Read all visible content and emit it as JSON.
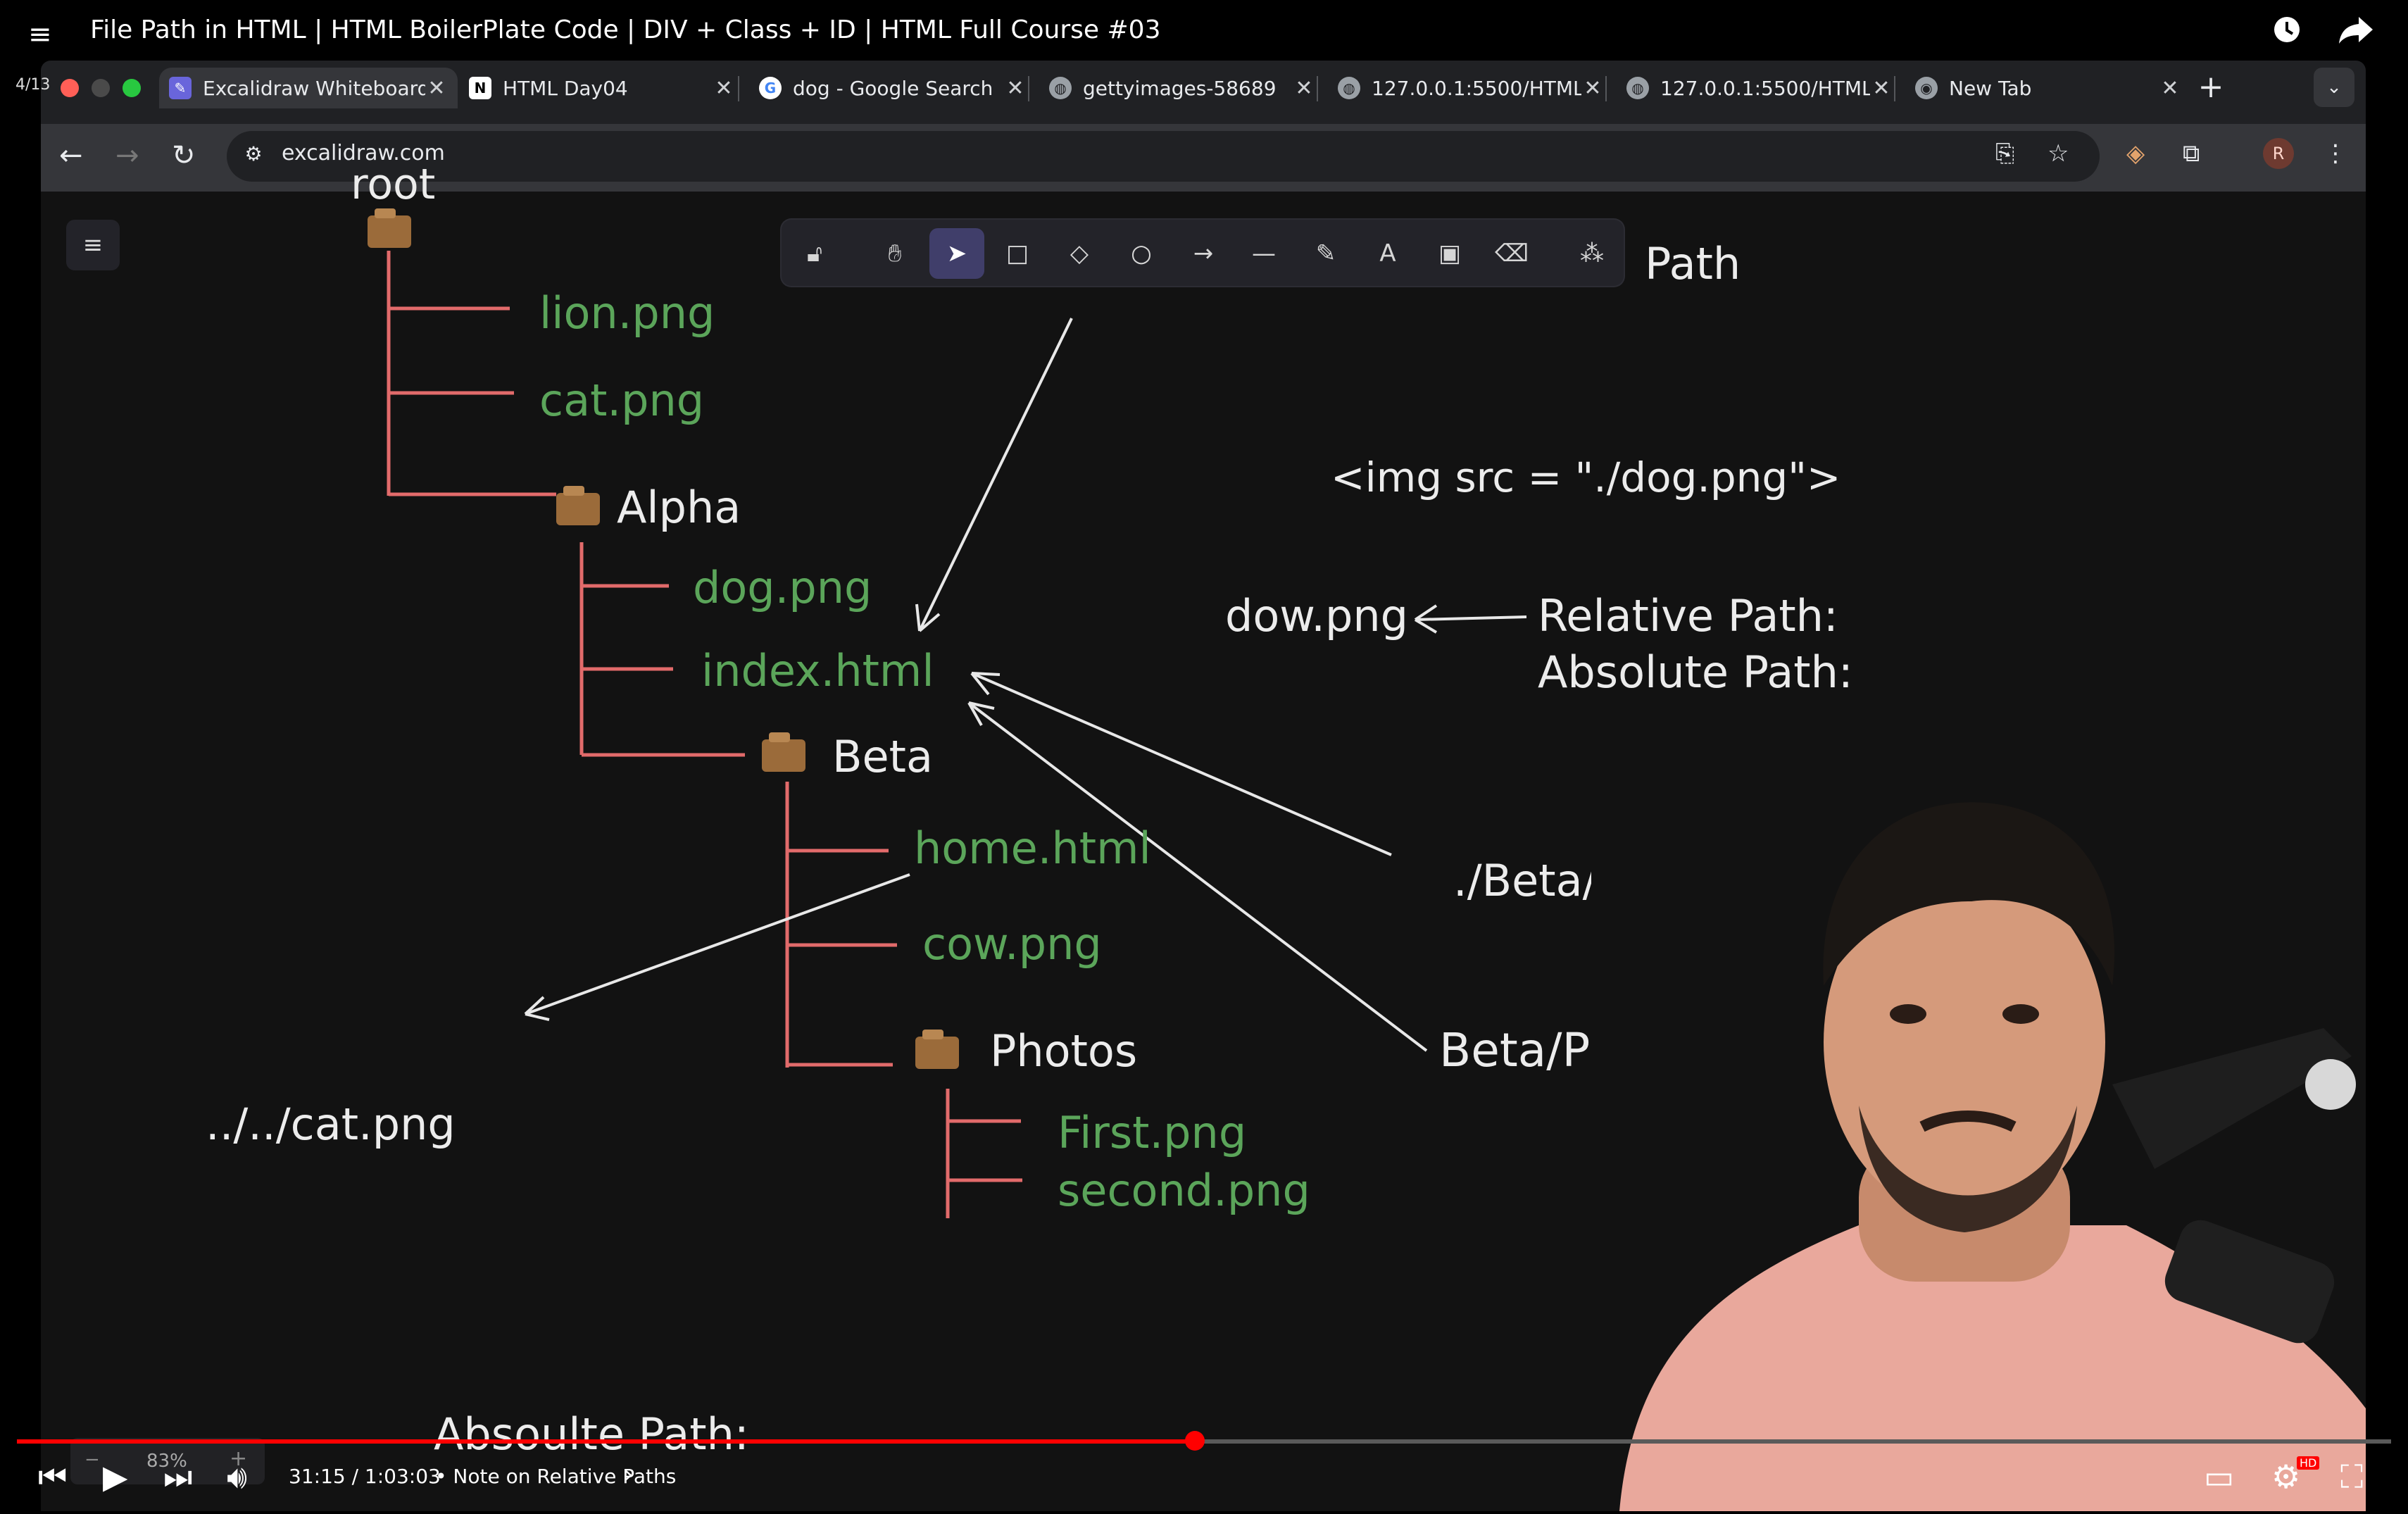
{
  "video": {
    "title": "File Path in HTML | HTML BoilerPlate Code | DIV + Class + ID | HTML Full Course #03",
    "counter": "4/13",
    "time": "31:15 / 1:03:03",
    "chapter": "• Note on Relative Paths",
    "progress_fraction": 0.496,
    "menu_icon": "playlist-icon"
  },
  "browser": {
    "tabs": [
      {
        "label": "Excalidraw Whiteboard",
        "icon": "excalidraw-icon",
        "active": true
      },
      {
        "label": "HTML Day04",
        "icon": "notion-icon"
      },
      {
        "label": "dog - Google Search",
        "icon": "google-icon"
      },
      {
        "label": "gettyimages-58689",
        "icon": "globe-icon"
      },
      {
        "label": "127.0.0.1:5500/HTML",
        "icon": "globe-icon"
      },
      {
        "label": "127.0.0.1:5500/HTML",
        "icon": "globe-icon"
      },
      {
        "label": "New Tab",
        "icon": "chrome-icon"
      }
    ],
    "url": "excalidraw.com",
    "profile_initial": "R"
  },
  "canvas": {
    "zoom": "83%",
    "tree": {
      "root_label": "root",
      "root_files": [
        "lion.png",
        "cat.png"
      ],
      "alpha": "Alpha",
      "alpha_files": [
        "dog.png",
        "index.html"
      ],
      "beta": "Beta",
      "beta_files": [
        "home.html",
        "cow.png"
      ],
      "photos": "Photos",
      "photos_files": [
        "First.png",
        "second.png"
      ]
    },
    "notes": {
      "top_path": "Path",
      "img_src": "<img src = \"./dog.png\">",
      "dow_png": "dow.png",
      "relative_path": "Relative Path:",
      "absolute_path": "Absolute Path:",
      "beta_cow": "./Beta/cow.png",
      "beta_photos": "Beta/Photos/seco",
      "cat_up": "../../cat.png",
      "absolute_path_bottom": "Absoulte Path:"
    }
  },
  "colors": {
    "green": "#5ba55a",
    "tree_line": "#e26b6b",
    "progress": "#ff0000",
    "canvas_bg": "#121212"
  }
}
